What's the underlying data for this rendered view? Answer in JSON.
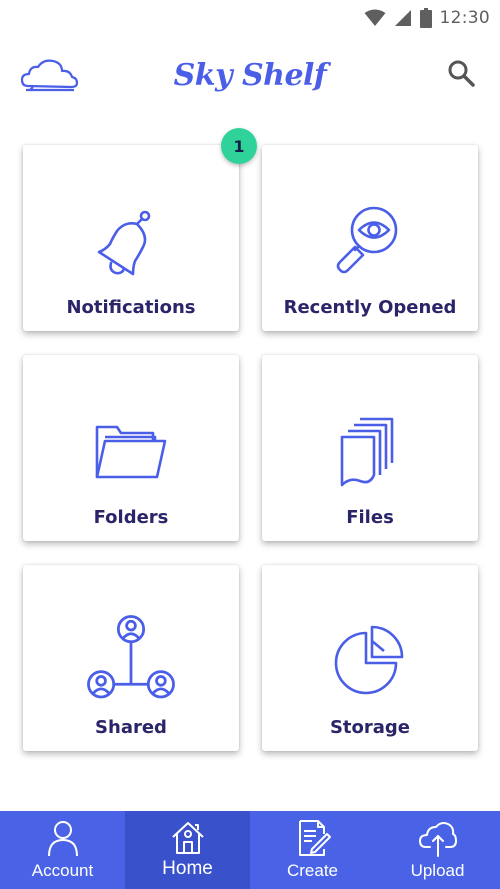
{
  "status_bar": {
    "time": "12:30",
    "icons": [
      "wifi-icon",
      "signal-icon",
      "battery-icon"
    ]
  },
  "header": {
    "logo_icon": "cloud-icon",
    "title": "Sky Shelf",
    "search_icon": "search-icon"
  },
  "tiles": [
    {
      "label": "Notifications",
      "icon": "bell-icon",
      "badge": "1"
    },
    {
      "label": "Recently Opened",
      "icon": "magnifier-eye-icon"
    },
    {
      "label": "Folders",
      "icon": "folder-icon"
    },
    {
      "label": "Files",
      "icon": "files-icon"
    },
    {
      "label": "Shared",
      "icon": "shared-users-icon"
    },
    {
      "label": "Storage",
      "icon": "pie-chart-icon"
    }
  ],
  "bottom_nav": [
    {
      "label": "Account",
      "icon": "user-icon",
      "active": false
    },
    {
      "label": "Home",
      "icon": "home-icon",
      "active": true
    },
    {
      "label": "Create",
      "icon": "edit-document-icon",
      "active": false
    },
    {
      "label": "Upload",
      "icon": "cloud-upload-icon",
      "active": false
    }
  ],
  "colors": {
    "accent": "#4a5ee8",
    "nav_background": "#4a63e6",
    "nav_active": "#3a51cc",
    "badge": "#2fd39a",
    "label_text": "#2a2468"
  }
}
